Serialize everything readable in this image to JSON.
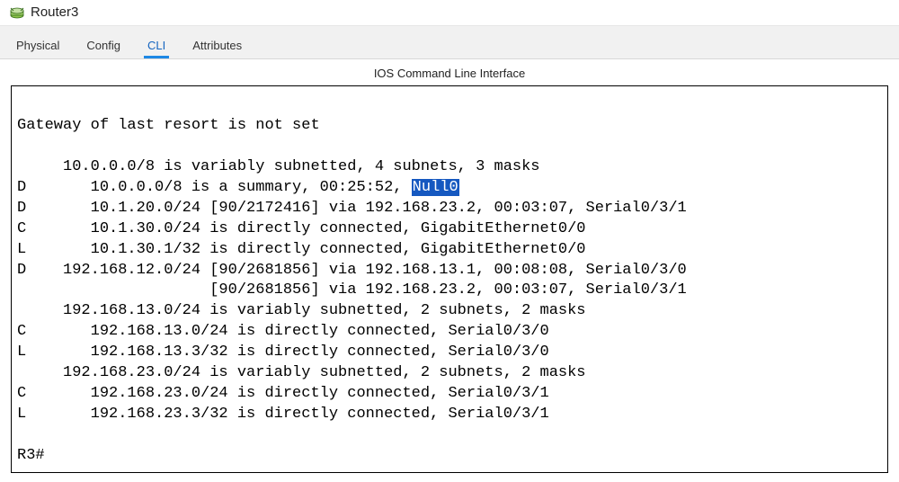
{
  "window": {
    "title": "Router3"
  },
  "tabs": {
    "physical": "Physical",
    "config": "Config",
    "cli": "CLI",
    "attributes": "Attributes"
  },
  "subtitle": "IOS Command Line Interface",
  "cli": {
    "l0": "",
    "l1": "Gateway of last resort is not set",
    "l2": "",
    "l3": "     10.0.0.0/8 is variably subnetted, 4 subnets, 3 masks",
    "l4a": "D       10.0.0.0/8 is a summary, 00:25:52, ",
    "l4h": "Null0",
    "l5": "D       10.1.20.0/24 [90/2172416] via 192.168.23.2, 00:03:07, Serial0/3/1",
    "l6": "C       10.1.30.0/24 is directly connected, GigabitEthernet0/0",
    "l7": "L       10.1.30.1/32 is directly connected, GigabitEthernet0/0",
    "l8": "D    192.168.12.0/24 [90/2681856] via 192.168.13.1, 00:08:08, Serial0/3/0",
    "l9": "                     [90/2681856] via 192.168.23.2, 00:03:07, Serial0/3/1",
    "l10": "     192.168.13.0/24 is variably subnetted, 2 subnets, 2 masks",
    "l11": "C       192.168.13.0/24 is directly connected, Serial0/3/0",
    "l12": "L       192.168.13.3/32 is directly connected, Serial0/3/0",
    "l13": "     192.168.23.0/24 is variably subnetted, 2 subnets, 2 masks",
    "l14": "C       192.168.23.0/24 is directly connected, Serial0/3/1",
    "l15": "L       192.168.23.3/32 is directly connected, Serial0/3/1",
    "l16": "",
    "prompt": "R3#"
  }
}
